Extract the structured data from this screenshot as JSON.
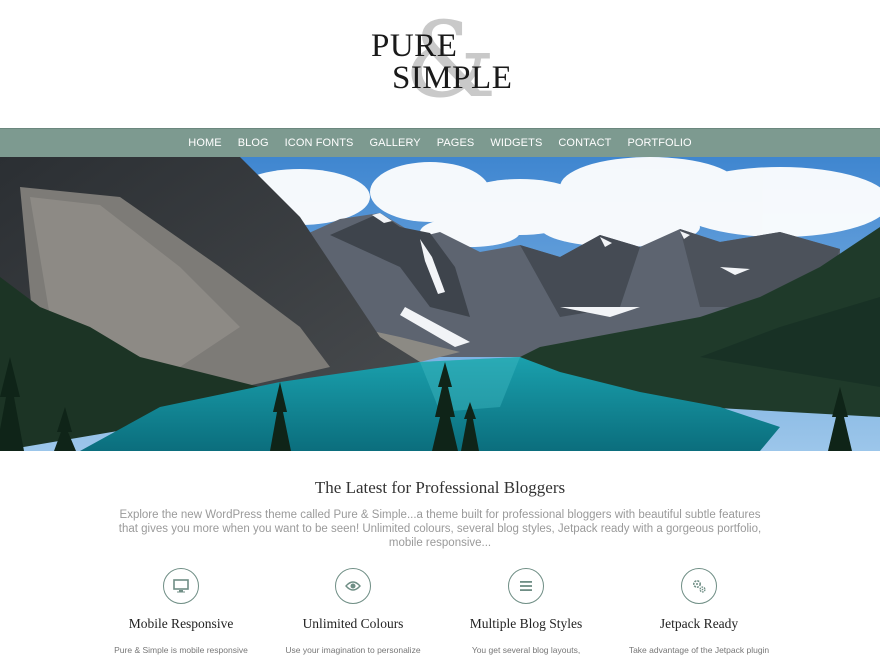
{
  "logo": {
    "word1": "PURE",
    "word2": "SIMPLE",
    "ampersand": "&"
  },
  "nav": [
    "HOME",
    "BLOG",
    "ICON FONTS",
    "GALLERY",
    "PAGES",
    "WIDGETS",
    "CONTACT",
    "PORTFOLIO"
  ],
  "intro": {
    "title": "The Latest for Professional Bloggers",
    "text": "Explore the new WordPress theme called Pure & Simple...a theme built for professional bloggers with beautiful subtle features that gives you more when you want to be seen! Unlimited colours, several blog styles, Jetpack ready with a gorgeous portfolio, mobile responsive..."
  },
  "features": [
    {
      "icon": "monitor-icon",
      "title": "Mobile Responsive",
      "desc": "Pure & Simple is mobile responsive for"
    },
    {
      "icon": "eye-icon",
      "title": "Unlimited Colours",
      "desc": "Use your imagination to personalize your"
    },
    {
      "icon": "list-icon",
      "title": "Multiple Blog Styles",
      "desc": "You get several blog layouts, including"
    },
    {
      "icon": "gears-icon",
      "title": "Jetpack Ready",
      "desc": "Take advantage of the Jetpack plugin and"
    }
  ],
  "colors": {
    "nav_bg": "#7d9a90",
    "accent": "#6f8e85",
    "logo_amp": "#c9c9c9"
  }
}
